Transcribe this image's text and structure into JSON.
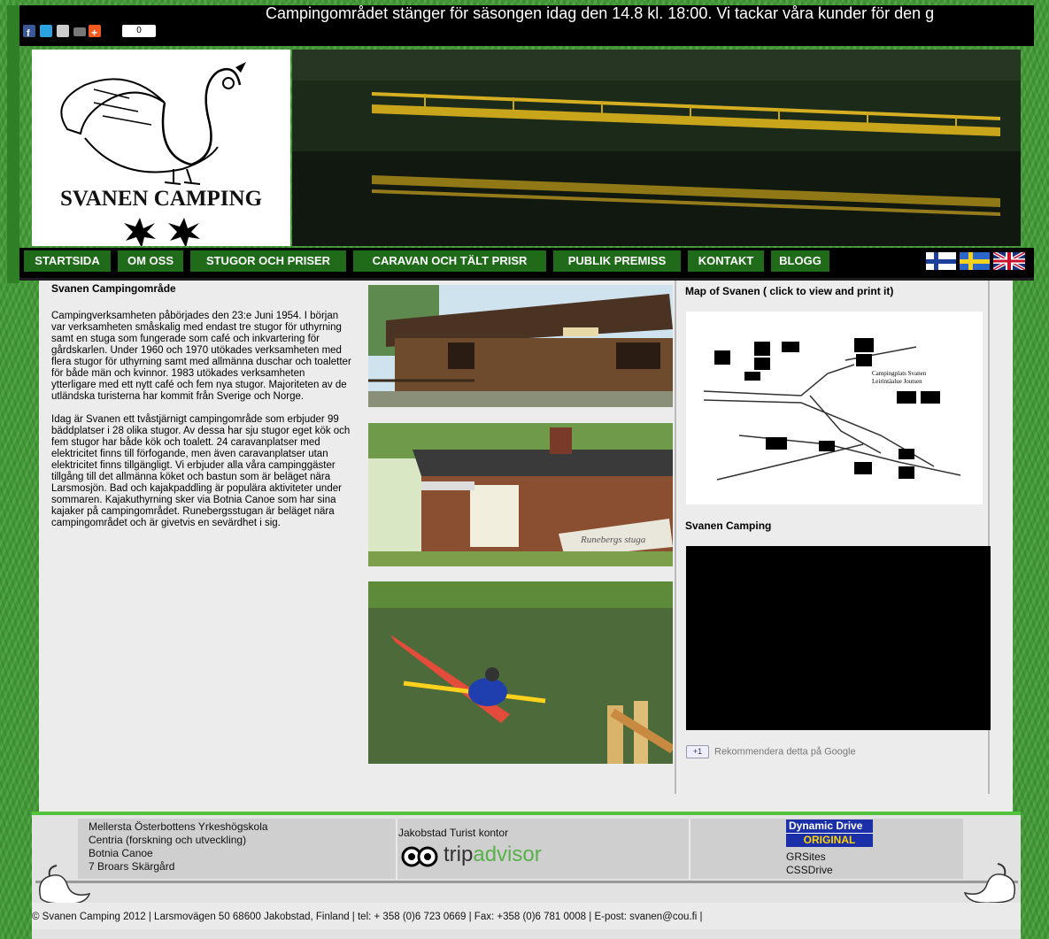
{
  "ticker": "Campingområdet stänger för säsongen idag den 14.8 kl. 18:00. Vi tackar våra kunder för den g",
  "share": {
    "count": "0",
    "icons": [
      "facebook-icon",
      "twitter-icon",
      "email-icon",
      "print-icon",
      "addthis-icon"
    ]
  },
  "logo": {
    "name": "SVANEN CAMPING"
  },
  "nav": {
    "items": [
      {
        "label": "STARTSIDA"
      },
      {
        "label": "OM OSS"
      },
      {
        "label": "STUGOR OCH PRISER"
      },
      {
        "label": "CARAVAN OCH TÄLT PRISR"
      },
      {
        "label": "PUBLIK PREMISS"
      },
      {
        "label": "KONTAKT"
      },
      {
        "label": "BLOGG"
      }
    ],
    "flags": [
      "finland-flag-icon",
      "sweden-flag-icon",
      "uk-flag-icon"
    ]
  },
  "content": {
    "heading": "Svanen Campingområde",
    "paragraph1": "Campingverksamheten påbörjades den 23:e Juni 1954. I början var verksamheten småskalig med endast tre stugor för uthyrning samt en stuga som fungerade som café och inkvartering för gårdskarlen. Under 1960 och 1970 utökades verksamheten med flera stugor för uthyrning samt med allmänna duschar och toaletter för både män och kvinnor. 1983 utökades verksamheten ytterligare med ett nytt café och fem nya stugor. Majoriteten av de utländska turisterna har kommit från Sverige och Norge.",
    "paragraph2": "Idag är Svanen ett tvåstjärnigt campingområde som erbjuder 99 bäddplatser i 28 olika stugor. Av dessa har sju stugor eget kök och fem stugor har både kök och toalett. 24 caravanplatser med elektricitet finns till förfogande, men även caravanplatser utan elektricitet finns tillgängligt. Vi erbjuder alla våra campinggäster tillgång till det allmänna köket och bastun som är beläget nära Larsmosjön. Bad och kajakpaddling är populära aktiviteter under sommaren. Kajakuthyrning sker via Botnia Canoe som har sina kajaker på campingområdet. Runebergsstugan är beläget nära campingområdet och är givetvis en sevärdhet i sig."
  },
  "photos": {
    "sign_text": "Runebergs stuga"
  },
  "sidebar": {
    "map_title": "Map of Svanen ( click to view and print it)",
    "map_label_line1": "Campingplats Svanen",
    "map_label_line2": "Leirintäalue Joutsen",
    "video_title": "Svanen Camping",
    "google_badge": "+1",
    "google_text": "Rekommendera detta på Google"
  },
  "footer": {
    "col1": [
      "Mellersta Österbottens Yrkeshögskola",
      "Centria (forskning och utveckling)",
      "Botnia Canoe",
      "7 Broars Skärgård"
    ],
    "col2_title": "Jakobstad Turist kontor",
    "tripadvisor_trip": "trip",
    "tripadvisor_advisor": "advisor",
    "dd_line1": "Dynamic Drive",
    "dd_line2": "ORIGINAL",
    "col3": [
      "GRSites",
      "CSSDrive"
    ],
    "copyright": "© Svanen Camping 2012 | Larsmovägen 50 68600 Jakobstad, Finland | tel: + 358 (0)6 723 0669 | Fax: +358 (0)6 781 0008 | E-post: svanen@cou.fi |"
  },
  "colors": {
    "nav_bg": "#1f6b1a",
    "page_green": "#3f9a32",
    "footer_accent": "#52c43c",
    "dynamicdrive_blue": "#1b2fa8"
  }
}
